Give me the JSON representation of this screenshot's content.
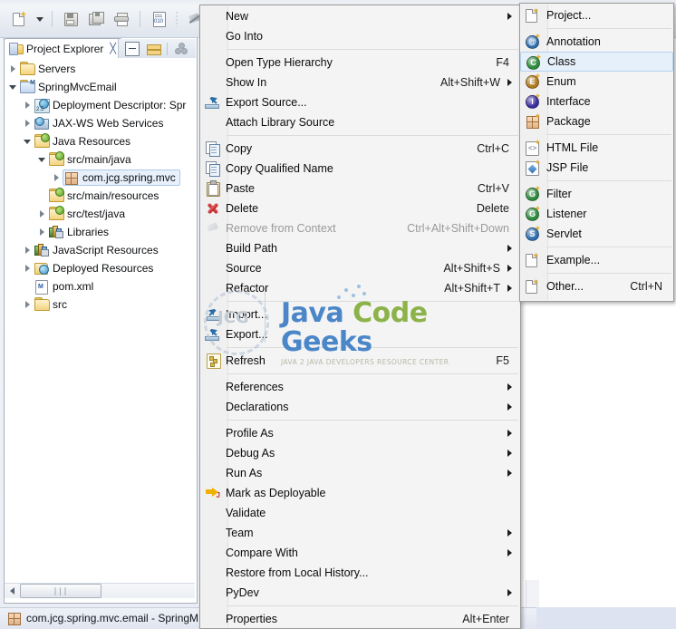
{
  "app": {
    "ide": "Eclipse"
  },
  "toolbar": {
    "buttons": [
      {
        "name": "new-wizard-button",
        "icon": "new-file-icon"
      },
      {
        "name": "new-wizard-dropdown",
        "icon": "chevron-down-icon"
      },
      {
        "name": "save-button",
        "icon": "save-icon"
      },
      {
        "name": "save-all-button",
        "icon": "save-all-icon"
      },
      {
        "name": "print-button",
        "icon": "print-icon"
      },
      {
        "name": "toggle-binary-button",
        "icon": "binary-file-icon"
      },
      {
        "name": "skip-breakpoints-button",
        "icon": "skip-all-breakpoints-icon"
      }
    ]
  },
  "view": {
    "tab_title": "Project Explorer",
    "close_glyph": "╳",
    "toolbar": [
      {
        "name": "collapse-all-button",
        "icon": "collapse-all-icon"
      },
      {
        "name": "link-with-editor-button",
        "icon": "link-editor-icon"
      },
      {
        "name": "view-menu-button",
        "icon": "view-menu-icon"
      }
    ]
  },
  "tree": {
    "items": [
      {
        "label": "Servers",
        "indent": 1,
        "arrow": "closed",
        "icon": "folder-icon",
        "selected": false
      },
      {
        "label": "SpringMvcEmail",
        "indent": 1,
        "arrow": "open",
        "icon": "project-folder-icon",
        "selected": false
      },
      {
        "label": "Deployment Descriptor: Spr",
        "indent": 2,
        "arrow": "closed",
        "icon": "deployment-descriptor-icon",
        "selected": false
      },
      {
        "label": "JAX-WS Web Services",
        "indent": 2,
        "arrow": "closed",
        "icon": "jaxws-icon",
        "selected": false
      },
      {
        "label": "Java Resources",
        "indent": 2,
        "arrow": "open",
        "icon": "java-resources-icon",
        "selected": false
      },
      {
        "label": "src/main/java",
        "indent": 3,
        "arrow": "open",
        "icon": "source-folder-icon",
        "selected": false
      },
      {
        "label": "com.jcg.spring.mvc",
        "indent": 4,
        "arrow": "closed",
        "icon": "package-icon",
        "selected": true
      },
      {
        "label": "src/main/resources",
        "indent": 3,
        "arrow": "none",
        "icon": "source-folder-icon",
        "selected": false
      },
      {
        "label": "src/test/java",
        "indent": 3,
        "arrow": "closed",
        "icon": "source-folder-icon",
        "selected": false
      },
      {
        "label": "Libraries",
        "indent": 3,
        "arrow": "closed",
        "icon": "libraries-icon",
        "selected": false
      },
      {
        "label": "JavaScript Resources",
        "indent": 2,
        "arrow": "closed",
        "icon": "libraries-icon",
        "selected": false
      },
      {
        "label": "Deployed Resources",
        "indent": 2,
        "arrow": "closed",
        "icon": "deployed-resources-icon",
        "selected": false
      },
      {
        "label": "pom.xml",
        "indent": 2,
        "arrow": "none",
        "icon": "xml-file-icon",
        "selected": false
      },
      {
        "label": "src",
        "indent": 2,
        "arrow": "closed",
        "icon": "folder-icon",
        "selected": false
      }
    ]
  },
  "scrollbar": {
    "grip_glyph": "∣∣∣"
  },
  "statusbar": {
    "selection_text": "com.jcg.spring.mvc.email - SpringM",
    "icon": "package-icon"
  },
  "context_menu": {
    "name": "project-explorer-context-menu",
    "items": [
      {
        "type": "item",
        "label": "New",
        "accel": "",
        "arrow": true,
        "icon": "",
        "disabled": false,
        "highlight": false
      },
      {
        "type": "item",
        "label": "Go Into",
        "accel": "",
        "arrow": false,
        "icon": "",
        "disabled": false,
        "highlight": false
      },
      {
        "type": "sep"
      },
      {
        "type": "item",
        "label": "Open Type Hierarchy",
        "accel": "F4",
        "arrow": false,
        "icon": "",
        "disabled": false,
        "highlight": false
      },
      {
        "type": "item",
        "label": "Show In",
        "accel": "Alt+Shift+W",
        "arrow": true,
        "icon": "",
        "disabled": false,
        "highlight": false
      },
      {
        "type": "item",
        "label": "Export Source...",
        "accel": "",
        "arrow": false,
        "icon": "export-source-icon",
        "disabled": false,
        "highlight": false
      },
      {
        "type": "item",
        "label": "Attach Library Source",
        "accel": "",
        "arrow": false,
        "icon": "",
        "disabled": false,
        "highlight": false
      },
      {
        "type": "sep"
      },
      {
        "type": "item",
        "label": "Copy",
        "accel": "Ctrl+C",
        "arrow": false,
        "icon": "copy-icon",
        "disabled": false,
        "highlight": false
      },
      {
        "type": "item",
        "label": "Copy Qualified Name",
        "accel": "",
        "arrow": false,
        "icon": "copy-qualified-icon",
        "disabled": false,
        "highlight": false
      },
      {
        "type": "item",
        "label": "Paste",
        "accel": "Ctrl+V",
        "arrow": false,
        "icon": "paste-icon",
        "disabled": false,
        "highlight": false
      },
      {
        "type": "item",
        "label": "Delete",
        "accel": "Delete",
        "arrow": false,
        "icon": "delete-icon",
        "disabled": false,
        "highlight": false
      },
      {
        "type": "item",
        "label": "Remove from Context",
        "accel": "Ctrl+Alt+Shift+Down",
        "arrow": false,
        "icon": "remove-context-icon",
        "disabled": true,
        "highlight": false
      },
      {
        "type": "item",
        "label": "Build Path",
        "accel": "",
        "arrow": true,
        "icon": "",
        "disabled": false,
        "highlight": false
      },
      {
        "type": "item",
        "label": "Source",
        "accel": "Alt+Shift+S",
        "arrow": true,
        "icon": "",
        "disabled": false,
        "highlight": false
      },
      {
        "type": "item",
        "label": "Refactor",
        "accel": "Alt+Shift+T",
        "arrow": true,
        "icon": "",
        "disabled": false,
        "highlight": false
      },
      {
        "type": "sep"
      },
      {
        "type": "item",
        "label": "Import...",
        "accel": "",
        "arrow": false,
        "icon": "import-icon",
        "disabled": false,
        "highlight": false
      },
      {
        "type": "item",
        "label": "Export...",
        "accel": "",
        "arrow": false,
        "icon": "export-icon",
        "disabled": false,
        "highlight": false
      },
      {
        "type": "sep"
      },
      {
        "type": "item",
        "label": "Refresh",
        "accel": "F5",
        "arrow": false,
        "icon": "refresh-icon",
        "disabled": false,
        "highlight": false
      },
      {
        "type": "sep"
      },
      {
        "type": "item",
        "label": "References",
        "accel": "",
        "arrow": true,
        "icon": "",
        "disabled": false,
        "highlight": false
      },
      {
        "type": "item",
        "label": "Declarations",
        "accel": "",
        "arrow": true,
        "icon": "",
        "disabled": false,
        "highlight": false
      },
      {
        "type": "sep"
      },
      {
        "type": "item",
        "label": "Profile As",
        "accel": "",
        "arrow": true,
        "icon": "",
        "disabled": false,
        "highlight": false
      },
      {
        "type": "item",
        "label": "Debug As",
        "accel": "",
        "arrow": true,
        "icon": "",
        "disabled": false,
        "highlight": false
      },
      {
        "type": "item",
        "label": "Run As",
        "accel": "",
        "arrow": true,
        "icon": "",
        "disabled": false,
        "highlight": false
      },
      {
        "type": "item",
        "label": "Mark as Deployable",
        "accel": "",
        "arrow": false,
        "icon": "mark-deployable-icon",
        "disabled": false,
        "highlight": false
      },
      {
        "type": "item",
        "label": "Validate",
        "accel": "",
        "arrow": false,
        "icon": "",
        "disabled": false,
        "highlight": false
      },
      {
        "type": "item",
        "label": "Team",
        "accel": "",
        "arrow": true,
        "icon": "",
        "disabled": false,
        "highlight": false
      },
      {
        "type": "item",
        "label": "Compare With",
        "accel": "",
        "arrow": true,
        "icon": "",
        "disabled": false,
        "highlight": false
      },
      {
        "type": "item",
        "label": "Restore from Local History...",
        "accel": "",
        "arrow": false,
        "icon": "",
        "disabled": false,
        "highlight": false
      },
      {
        "type": "item",
        "label": "PyDev",
        "accel": "",
        "arrow": true,
        "icon": "",
        "disabled": false,
        "highlight": false
      },
      {
        "type": "sep"
      },
      {
        "type": "item",
        "label": "Properties",
        "accel": "Alt+Enter",
        "arrow": false,
        "icon": "",
        "disabled": false,
        "highlight": false
      }
    ]
  },
  "new_submenu": {
    "name": "new-submenu",
    "items": [
      {
        "type": "item",
        "label": "Project...",
        "accel": "",
        "icon": "new-project-icon",
        "highlight": false
      },
      {
        "type": "sep"
      },
      {
        "type": "item",
        "label": "Annotation",
        "accel": "",
        "icon": "new-annotation-icon",
        "highlight": false,
        "badge": "@",
        "color": "#2f6fae"
      },
      {
        "type": "item",
        "label": "Class",
        "accel": "",
        "icon": "new-class-icon",
        "highlight": true,
        "badge": "C",
        "color": "#2e8b3d"
      },
      {
        "type": "item",
        "label": "Enum",
        "accel": "",
        "icon": "new-enum-icon",
        "highlight": false,
        "badge": "E",
        "color": "#b07a1e"
      },
      {
        "type": "item",
        "label": "Interface",
        "accel": "",
        "icon": "new-interface-icon",
        "highlight": false,
        "badge": "I",
        "color": "#3b2f9e"
      },
      {
        "type": "item",
        "label": "Package",
        "accel": "",
        "icon": "new-package-icon",
        "highlight": false
      },
      {
        "type": "sep"
      },
      {
        "type": "item",
        "label": "HTML File",
        "accel": "",
        "icon": "new-html-file-icon",
        "highlight": false
      },
      {
        "type": "item",
        "label": "JSP File",
        "accel": "",
        "icon": "new-jsp-file-icon",
        "highlight": false
      },
      {
        "type": "sep"
      },
      {
        "type": "item",
        "label": "Filter",
        "accel": "",
        "icon": "new-filter-icon",
        "highlight": false,
        "badge": "G",
        "color": "#2e8b3d"
      },
      {
        "type": "item",
        "label": "Listener",
        "accel": "",
        "icon": "new-listener-icon",
        "highlight": false,
        "badge": "G",
        "color": "#2e8b3d"
      },
      {
        "type": "item",
        "label": "Servlet",
        "accel": "",
        "icon": "new-servlet-icon",
        "highlight": false,
        "badge": "S",
        "color": "#2f6fae"
      },
      {
        "type": "sep"
      },
      {
        "type": "item",
        "label": "Example...",
        "accel": "",
        "icon": "new-example-icon",
        "highlight": false
      },
      {
        "type": "sep"
      },
      {
        "type": "item",
        "label": "Other...",
        "accel": "Ctrl+N",
        "icon": "new-other-icon",
        "highlight": false
      }
    ]
  },
  "watermark": {
    "line1_part1": "Java ",
    "line1_part2": "Code ",
    "line1_part3": "Geeks",
    "line2": "JAVA 2 JAVA DEVELOPERS RESOURCE CENTER",
    "logo_text": "JCG"
  },
  "colors": {
    "menu_bg": "#f4f4f4",
    "menu_border": "#9a9a9a",
    "highlight_bg": "#e6f0fa",
    "highlight_border": "#b6d2ee",
    "tree_selection_bg": "#e8f1fb",
    "tree_selection_border": "#a9c9e8",
    "disabled_text": "#9a9a9a",
    "watermark_blue": "#4a86c8",
    "watermark_green": "#8cb34a"
  }
}
